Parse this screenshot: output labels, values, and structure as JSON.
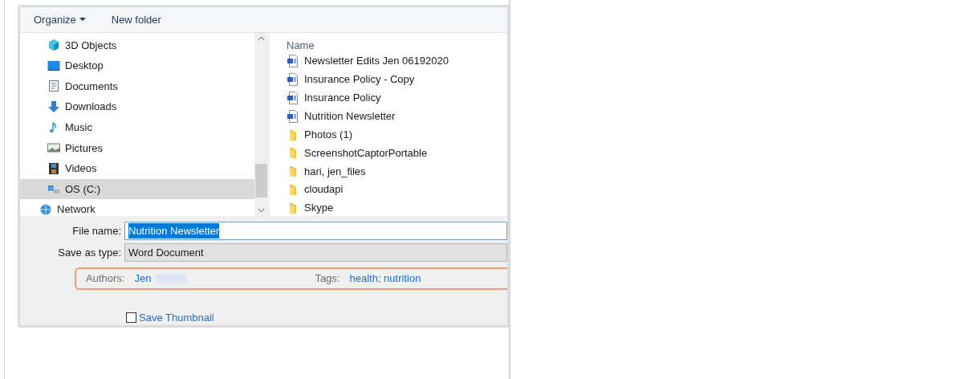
{
  "toolbar": {
    "organize": "Organize",
    "new_folder": "New folder"
  },
  "nav_items": [
    {
      "kind": "cube",
      "label": "3D Objects",
      "selected": false
    },
    {
      "kind": "desktop",
      "label": "Desktop",
      "selected": false
    },
    {
      "kind": "documents",
      "label": "Documents",
      "selected": false
    },
    {
      "kind": "downloads",
      "label": "Downloads",
      "selected": false
    },
    {
      "kind": "music",
      "label": "Music",
      "selected": false
    },
    {
      "kind": "pictures",
      "label": "Pictures",
      "selected": false
    },
    {
      "kind": "videos",
      "label": "Videos",
      "selected": false
    },
    {
      "kind": "drive",
      "label": "OS (C:)",
      "selected": true
    },
    {
      "kind": "network",
      "label": "Network",
      "selected": false
    }
  ],
  "file_list": {
    "column": "Name",
    "files": [
      {
        "kind": "word",
        "name": "Newsletter Edits Jen 06192020"
      },
      {
        "kind": "word",
        "name": "Insurance Policy - Copy"
      },
      {
        "kind": "word",
        "name": "Insurance Policy"
      },
      {
        "kind": "word",
        "name": "Nutrition Newsletter"
      },
      {
        "kind": "folder",
        "name": "Photos (1)"
      },
      {
        "kind": "folder",
        "name": "ScreenshotCaptorPortable"
      },
      {
        "kind": "folder",
        "name": "hari, jen_files"
      },
      {
        "kind": "folder",
        "name": "cloudapi"
      },
      {
        "kind": "folder",
        "name": "Skype"
      }
    ]
  },
  "file_name": {
    "label": "File name:",
    "value": "Nutrition Newsletter"
  },
  "save_as_type": {
    "label": "Save as type:",
    "value": "Word Document"
  },
  "metadata": {
    "authors_label": "Authors:",
    "authors": "Jen",
    "tags_label": "Tags:",
    "tags": "health; nutrition"
  },
  "save_thumbnail": {
    "label": "Save Thumbnail",
    "checked": false
  }
}
